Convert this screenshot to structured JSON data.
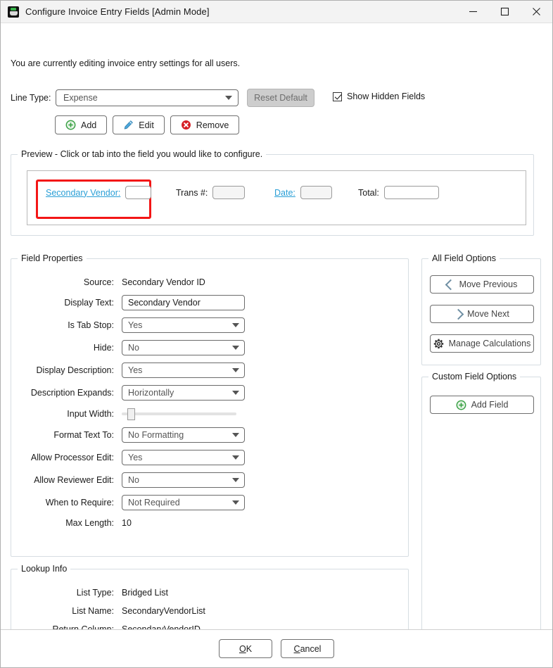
{
  "window": {
    "title": "Configure Invoice Entry Fields [Admin Mode]",
    "app_icon": "app-icon",
    "minimize_icon": "minimize-icon",
    "maximize_icon": "maximize-icon",
    "close_icon": "close-icon"
  },
  "notice": "You are currently editing invoice entry settings for all users.",
  "toolbar": {
    "line_type_label": "Line Type:",
    "line_type_value": "Expense",
    "reset_default_label": "Reset Default",
    "show_hidden_label": "Show Hidden Fields",
    "show_hidden_checked": true,
    "add_label": "Add",
    "edit_label": "Edit",
    "remove_label": "Remove"
  },
  "preview": {
    "legend": "Preview - Click or tab into the field you would like to configure.",
    "fields": [
      {
        "label": "Secondary Vendor:",
        "link": true,
        "selected": true
      },
      {
        "label": "Trans #:",
        "link": false,
        "selected": false
      },
      {
        "label": "Date:",
        "link": true,
        "selected": false
      },
      {
        "label": "Total:",
        "link": false,
        "selected": false
      }
    ]
  },
  "field_properties": {
    "legend": "Field Properties",
    "rows": [
      {
        "label": "Source:",
        "value": "Secondary Vendor ID",
        "type": "static"
      },
      {
        "label": "Display Text:",
        "value": "Secondary Vendor",
        "type": "text"
      },
      {
        "label": "Is Tab Stop:",
        "value": "Yes",
        "type": "combo"
      },
      {
        "label": "Hide:",
        "value": "No",
        "type": "combo"
      },
      {
        "label": "Display Description:",
        "value": "Yes",
        "type": "combo"
      },
      {
        "label": "Description Expands:",
        "value": "Horizontally",
        "type": "combo"
      },
      {
        "label": "Input Width:",
        "value": "",
        "type": "slider"
      },
      {
        "label": "Format Text To:",
        "value": "No Formatting",
        "type": "combo"
      },
      {
        "label": "Allow Processor Edit:",
        "value": "Yes",
        "type": "combo"
      },
      {
        "label": "Allow Reviewer Edit:",
        "value": "No",
        "type": "combo"
      },
      {
        "label": "When to Require:",
        "value": "Not Required",
        "type": "combo"
      },
      {
        "label": "Max Length:",
        "value": "10",
        "type": "static"
      }
    ]
  },
  "lookup_info": {
    "legend": "Lookup Info",
    "rows": [
      {
        "label": "List Type:",
        "value": "Bridged List"
      },
      {
        "label": "List Name:",
        "value": "SecondaryVendorList"
      },
      {
        "label": "Return Column:",
        "value": "SecondaryVendorID"
      }
    ]
  },
  "all_field_options": {
    "legend": "All Field Options",
    "move_previous_label": "Move Previous",
    "move_next_label": "Move Next",
    "manage_calculations_label": "Manage Calculations"
  },
  "custom_field_options": {
    "legend": "Custom Field Options",
    "add_field_label": "Add Field"
  },
  "footer": {
    "ok_mnemonic": "O",
    "ok_rest": "K",
    "cancel_mnemonic": "C",
    "cancel_rest": "ancel"
  },
  "colors": {
    "link": "#2a9fd6",
    "highlight": "#f31616",
    "add_green": "#3aa145",
    "edit_blue": "#4fa8dd",
    "remove_red": "#d61f26",
    "titlebar": "#f3f3f3"
  }
}
